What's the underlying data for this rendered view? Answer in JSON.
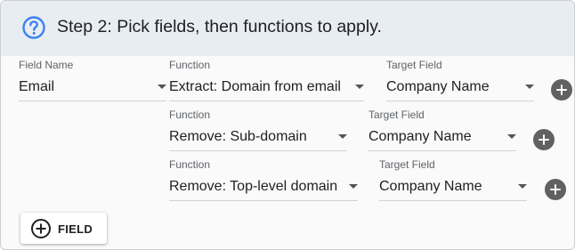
{
  "header": {
    "title": "Step 2: Pick fields, then functions to apply.",
    "icon": "help-circle-icon",
    "accent_color": "#3b82f0"
  },
  "mapping": {
    "field_name_label": "Field Name",
    "field_name_value": "Email",
    "rows": [
      {
        "function_label": "Function",
        "function_value": "Extract: Domain from email",
        "target_label": "Target Field",
        "target_value": "Company Name"
      },
      {
        "function_label": "Function",
        "function_value": "Remove: Sub-domain",
        "target_label": "Target Field",
        "target_value": "Company Name"
      },
      {
        "function_label": "Function",
        "function_value": "Remove: Top-level domain",
        "target_label": "Target Field",
        "target_value": "Company Name"
      }
    ]
  },
  "add_field_button": {
    "label": "FIELD",
    "icon": "add-circle-outline-icon"
  }
}
